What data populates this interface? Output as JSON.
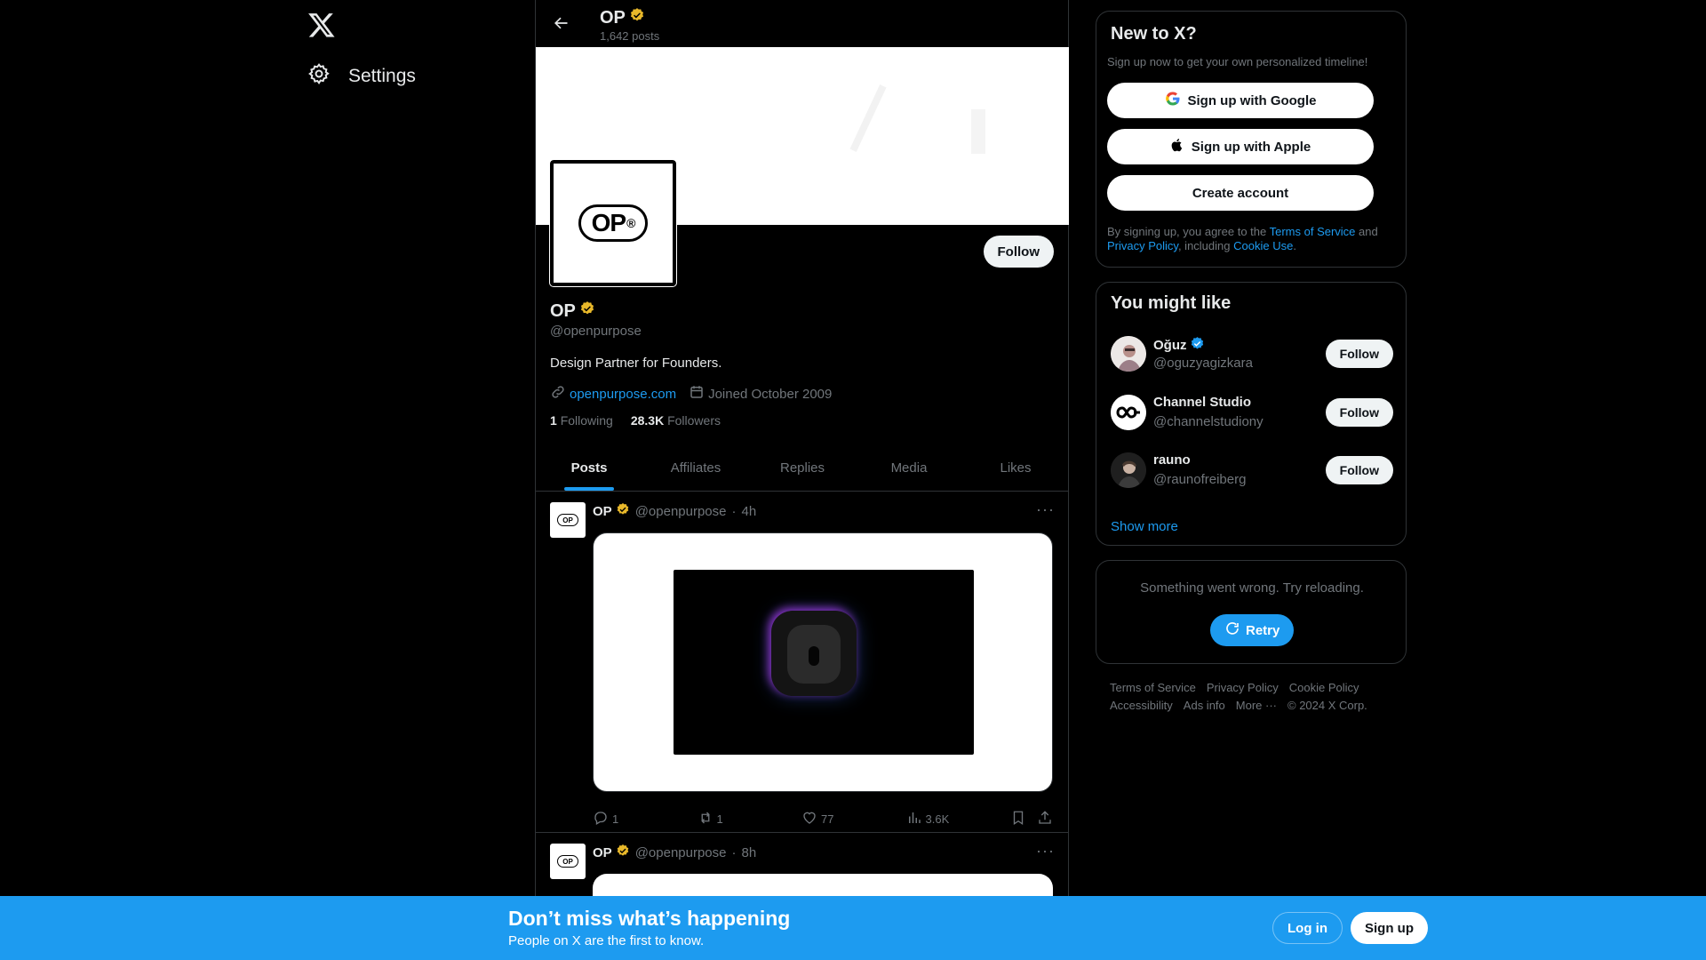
{
  "nav": {
    "logo_icon": "x-logo-icon",
    "settings_label": "Settings"
  },
  "header": {
    "name": "OP",
    "post_count": "1,642 posts"
  },
  "profile": {
    "name": "OP",
    "handle": "@openpurpose",
    "bio": "Design Partner for Founders.",
    "website": "openpurpose.com",
    "joined": "Joined October 2009",
    "following_count": "1",
    "following_label": "Following",
    "followers_count": "28.3K",
    "followers_label": "Followers",
    "follow_label": "Follow",
    "avatar_text": "OP",
    "avatar_reg": "®",
    "verified_color": "#e8b82a"
  },
  "tabs": [
    {
      "label": "Posts",
      "active": true
    },
    {
      "label": "Affiliates"
    },
    {
      "label": "Replies"
    },
    {
      "label": "Media"
    },
    {
      "label": "Likes"
    }
  ],
  "posts": [
    {
      "name": "OP",
      "handle": "@openpurpose",
      "time": "4h",
      "replies": "1",
      "reposts": "1",
      "likes": "77",
      "views": "3.6K"
    },
    {
      "name": "OP",
      "handle": "@openpurpose",
      "time": "8h"
    }
  ],
  "new_to_x": {
    "title": "New to X?",
    "subtitle": "Sign up now to get your own personalized timeline!",
    "google_label": "Sign up with Google",
    "apple_label": "Sign up with Apple",
    "create_label": "Create account",
    "legal_prefix": "By signing up, you agree to the ",
    "terms_link": "Terms of Service",
    "legal_and": " and ",
    "privacy_link": "Privacy Policy",
    "legal_including": ", including ",
    "cookie_link": "Cookie Use",
    "legal_end": "."
  },
  "you_might_like": {
    "title": "You might like",
    "follow_label": "Follow",
    "show_more": "Show more",
    "accounts": [
      {
        "name": "Oğuz",
        "handle": "@oguzyagizkara",
        "verified": true
      },
      {
        "name": "Channel Studio",
        "handle": "@channelstudiony"
      },
      {
        "name": "rauno",
        "handle": "@raunofreiberg"
      }
    ]
  },
  "error_card": {
    "message": "Something went wrong. Try reloading.",
    "retry_label": "Retry"
  },
  "footer": {
    "links": [
      "Terms of Service",
      "Privacy Policy",
      "Cookie Policy",
      "Accessibility",
      "Ads info",
      "More ···"
    ],
    "copyright": "© 2024 X Corp."
  },
  "bottom_bar": {
    "title": "Don’t miss what’s happening",
    "subtitle": "People on X are the first to know.",
    "login_label": "Log in",
    "signup_label": "Sign up"
  },
  "colors": {
    "accent": "#1d9bf0",
    "gold_badge": "#e8b82a",
    "blue_badge": "#1d9bf0"
  }
}
